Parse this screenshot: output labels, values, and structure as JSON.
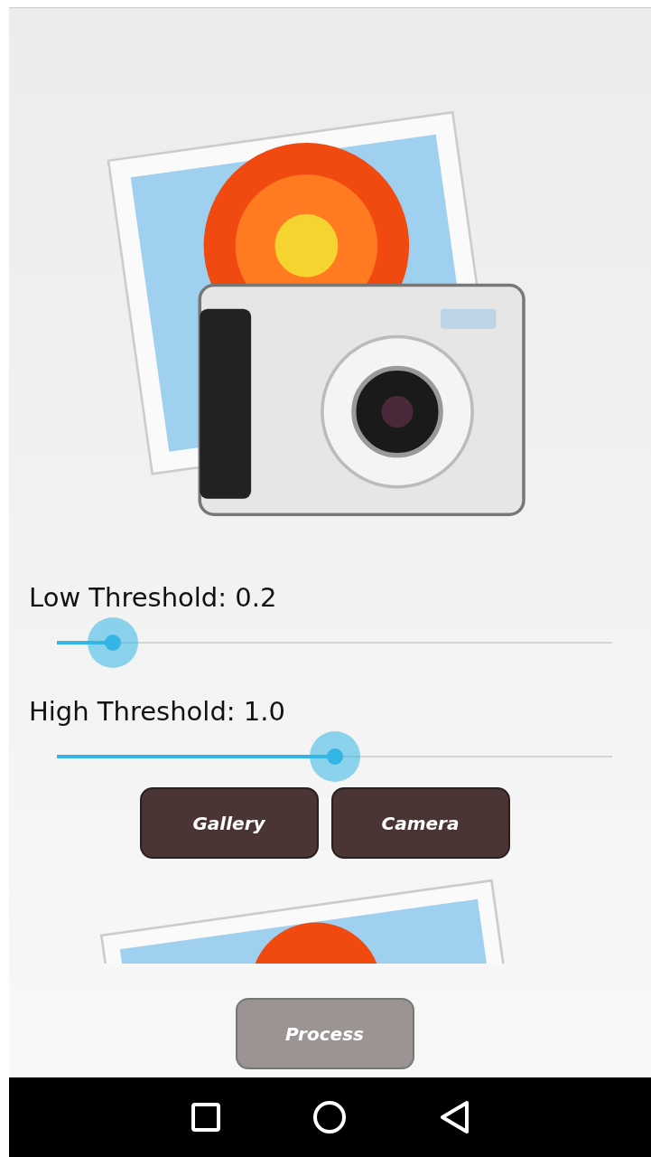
{
  "sliders": [
    {
      "label": "Low Threshold: 0.2",
      "level": 0.1
    },
    {
      "label": "High Threshold: 1.0",
      "level": 0.5
    }
  ],
  "buttons": [
    {
      "label": "Gallery",
      "disabled": false
    },
    {
      "label": "Camera",
      "disabled": false
    }
  ],
  "process_button": {
    "label": "Process",
    "disabled": true
  }
}
